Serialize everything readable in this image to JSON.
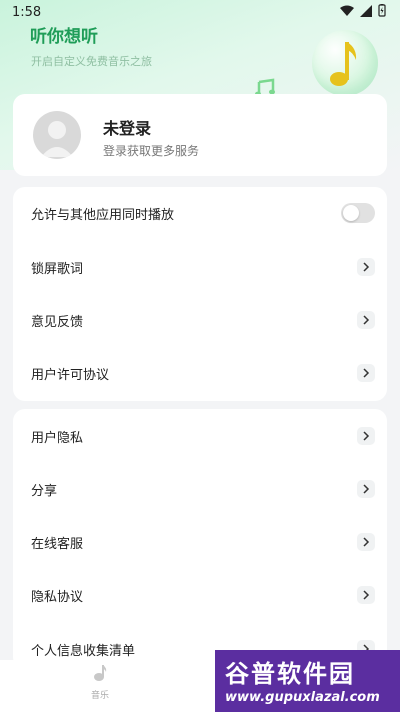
{
  "status_bar": {
    "time": "1:58"
  },
  "header": {
    "title": "听你想听",
    "subtitle": "开启自定义免费音乐之旅"
  },
  "profile": {
    "name": "未登录",
    "subtitle": "登录获取更多服务"
  },
  "settings": {
    "group1": [
      {
        "label": "允许与其他应用同时播放",
        "control": "toggle",
        "enabled": false
      },
      {
        "label": "锁屏歌词",
        "control": "chevron"
      },
      {
        "label": "意见反馈",
        "control": "chevron"
      },
      {
        "label": "用户许可协议",
        "control": "chevron"
      }
    ],
    "group2": [
      {
        "label": "用户隐私",
        "control": "chevron"
      },
      {
        "label": "分享",
        "control": "chevron"
      },
      {
        "label": "在线客服",
        "control": "chevron"
      },
      {
        "label": "隐私协议",
        "control": "chevron"
      },
      {
        "label": "个人信息收集清单",
        "control": "chevron"
      }
    ]
  },
  "tab_bar": {
    "items": [
      {
        "label": "音乐",
        "icon": "music-note-icon"
      }
    ]
  },
  "watermark": {
    "title": "谷普软件园",
    "url": "www.gupuxlazal.com"
  },
  "colors": {
    "accent": "#1f9d58",
    "background": "#f3f4f6",
    "card": "#ffffff"
  }
}
